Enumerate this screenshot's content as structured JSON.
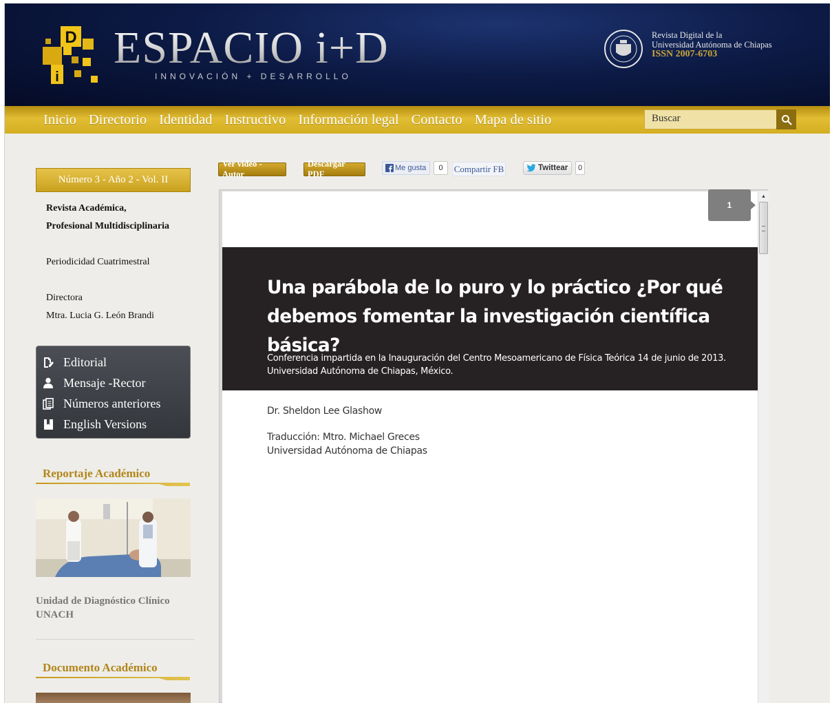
{
  "header": {
    "logo_text": "ESPACIO i+D",
    "logo_subtitle": "INNOVACIÓN + DESARROLLO",
    "university_line1": "Revista Digital de la",
    "university_line2": "Universidad Autónoma de Chiapas",
    "issn": "ISSN 2007-6703"
  },
  "nav": {
    "items": [
      "Inicio",
      "Directorio",
      "Identidad",
      "Instructivo",
      "Información legal",
      "Contacto",
      "Mapa de sitio"
    ],
    "search_placeholder": "Buscar"
  },
  "sidebar": {
    "issue": "Número 3 - Año 2 - Vol. II",
    "journal_line1": "Revista Académica,",
    "journal_line2": "Profesional Multidisciplinaria",
    "periodicity": "Periodicidad Cuatrimestral",
    "director_label": "Directora",
    "director_name": "Mtra. Lucia G. León Brandi",
    "menu": [
      {
        "label": "Editorial",
        "icon": "document-edit-icon"
      },
      {
        "label": "Mensaje -Rector",
        "icon": "user-icon"
      },
      {
        "label": "Números anteriores",
        "icon": "documents-icon"
      },
      {
        "label": "English Versions",
        "icon": "bookmark-page-icon"
      }
    ],
    "section1_title": "Reportaje Académico",
    "photo_caption_line1": "Unidad de Diagnóstico Clínico",
    "photo_caption_line2": "UNACH",
    "section2_title": "Documento Académico"
  },
  "actions": {
    "video_label": "Ver video -Autor",
    "pdf_label": "Descargar PDF",
    "like_label": "Me gusta",
    "like_count": "0",
    "share_label": "Compartir FB",
    "tweet_label": "Twittear",
    "tweet_count": "0"
  },
  "document": {
    "page_number": "1",
    "title_line1": "Una parábola de lo puro y lo práctico ¿Por qué",
    "title_line2": "debemos fomentar la investigación científica básica?",
    "subtitle_line1": "Conferencia impartida en la Inauguración del Centro Mesoamericano de Física Teórica 14 de junio de 2013.",
    "subtitle_line2": "Universidad Autónoma de Chiapas, México.",
    "author": "Dr. Sheldon Lee Glashow",
    "translation": "Traducción: Mtro. Michael Greces",
    "translation_affiliation": "Universidad Autónoma de Chiapas"
  },
  "colors": {
    "header_navy": "#0c1a45",
    "gold": "#d4ae22",
    "banner_dark": "#262122",
    "sidebar_menu": "#3f4348"
  }
}
